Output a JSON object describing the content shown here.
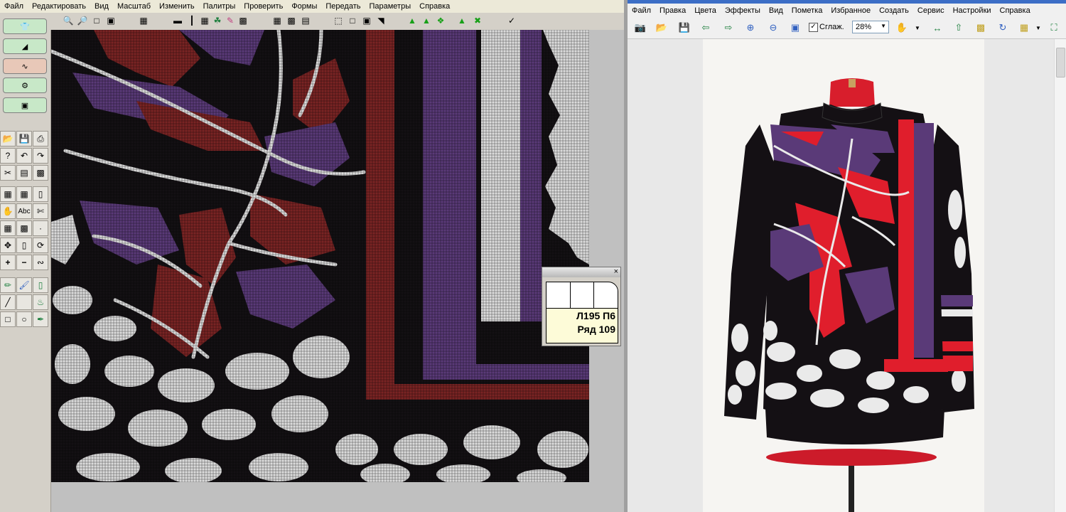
{
  "left_app": {
    "menu": [
      "Файл",
      "Редактировать",
      "Вид",
      "Масштаб",
      "Изменить",
      "Палитры",
      "Проверить",
      "Формы",
      "Передать",
      "Параметры",
      "Справка"
    ],
    "toolbar_icons": [
      "zoom-in-icon",
      "zoom-out-icon",
      "zoom-fit-icon",
      "zoom-window-icon",
      "knit-machine-icon",
      "ruler-icon",
      "needle-icon",
      "grid-icon",
      "yarn-icon",
      "color-brush-icon",
      "grid-dots-icon",
      "select-rect-icon",
      "select-box-icon",
      "select-move-icon",
      "select-corner-icon",
      "palette-grid-icon",
      "palette-table-icon",
      "color-chart-icon",
      "carriage-a-icon",
      "carriage-b-icon",
      "carriage-c-icon",
      "carriage-d-icon",
      "carriage-e-icon",
      "check-icon"
    ],
    "popup": {
      "needles": "Л195 П6",
      "row": "Ряд 109",
      "close": "×"
    },
    "side_text_tool": "Abc"
  },
  "right_app": {
    "menu": [
      "Файл",
      "Правка",
      "Цвета",
      "Эффекты",
      "Вид",
      "Пометка",
      "Избранное",
      "Создать",
      "Сервис",
      "Настройки",
      "Справка"
    ],
    "smooth_label": "Сглаж.",
    "smooth_checked": "✓",
    "zoom": "28%"
  },
  "colors": {
    "black": "#141014",
    "purple": "#5a3a78",
    "dark_red": "#7a2424",
    "white_grid": "#dcdcdc",
    "red": "#e01e2c",
    "panel": "#d4d0c8"
  }
}
